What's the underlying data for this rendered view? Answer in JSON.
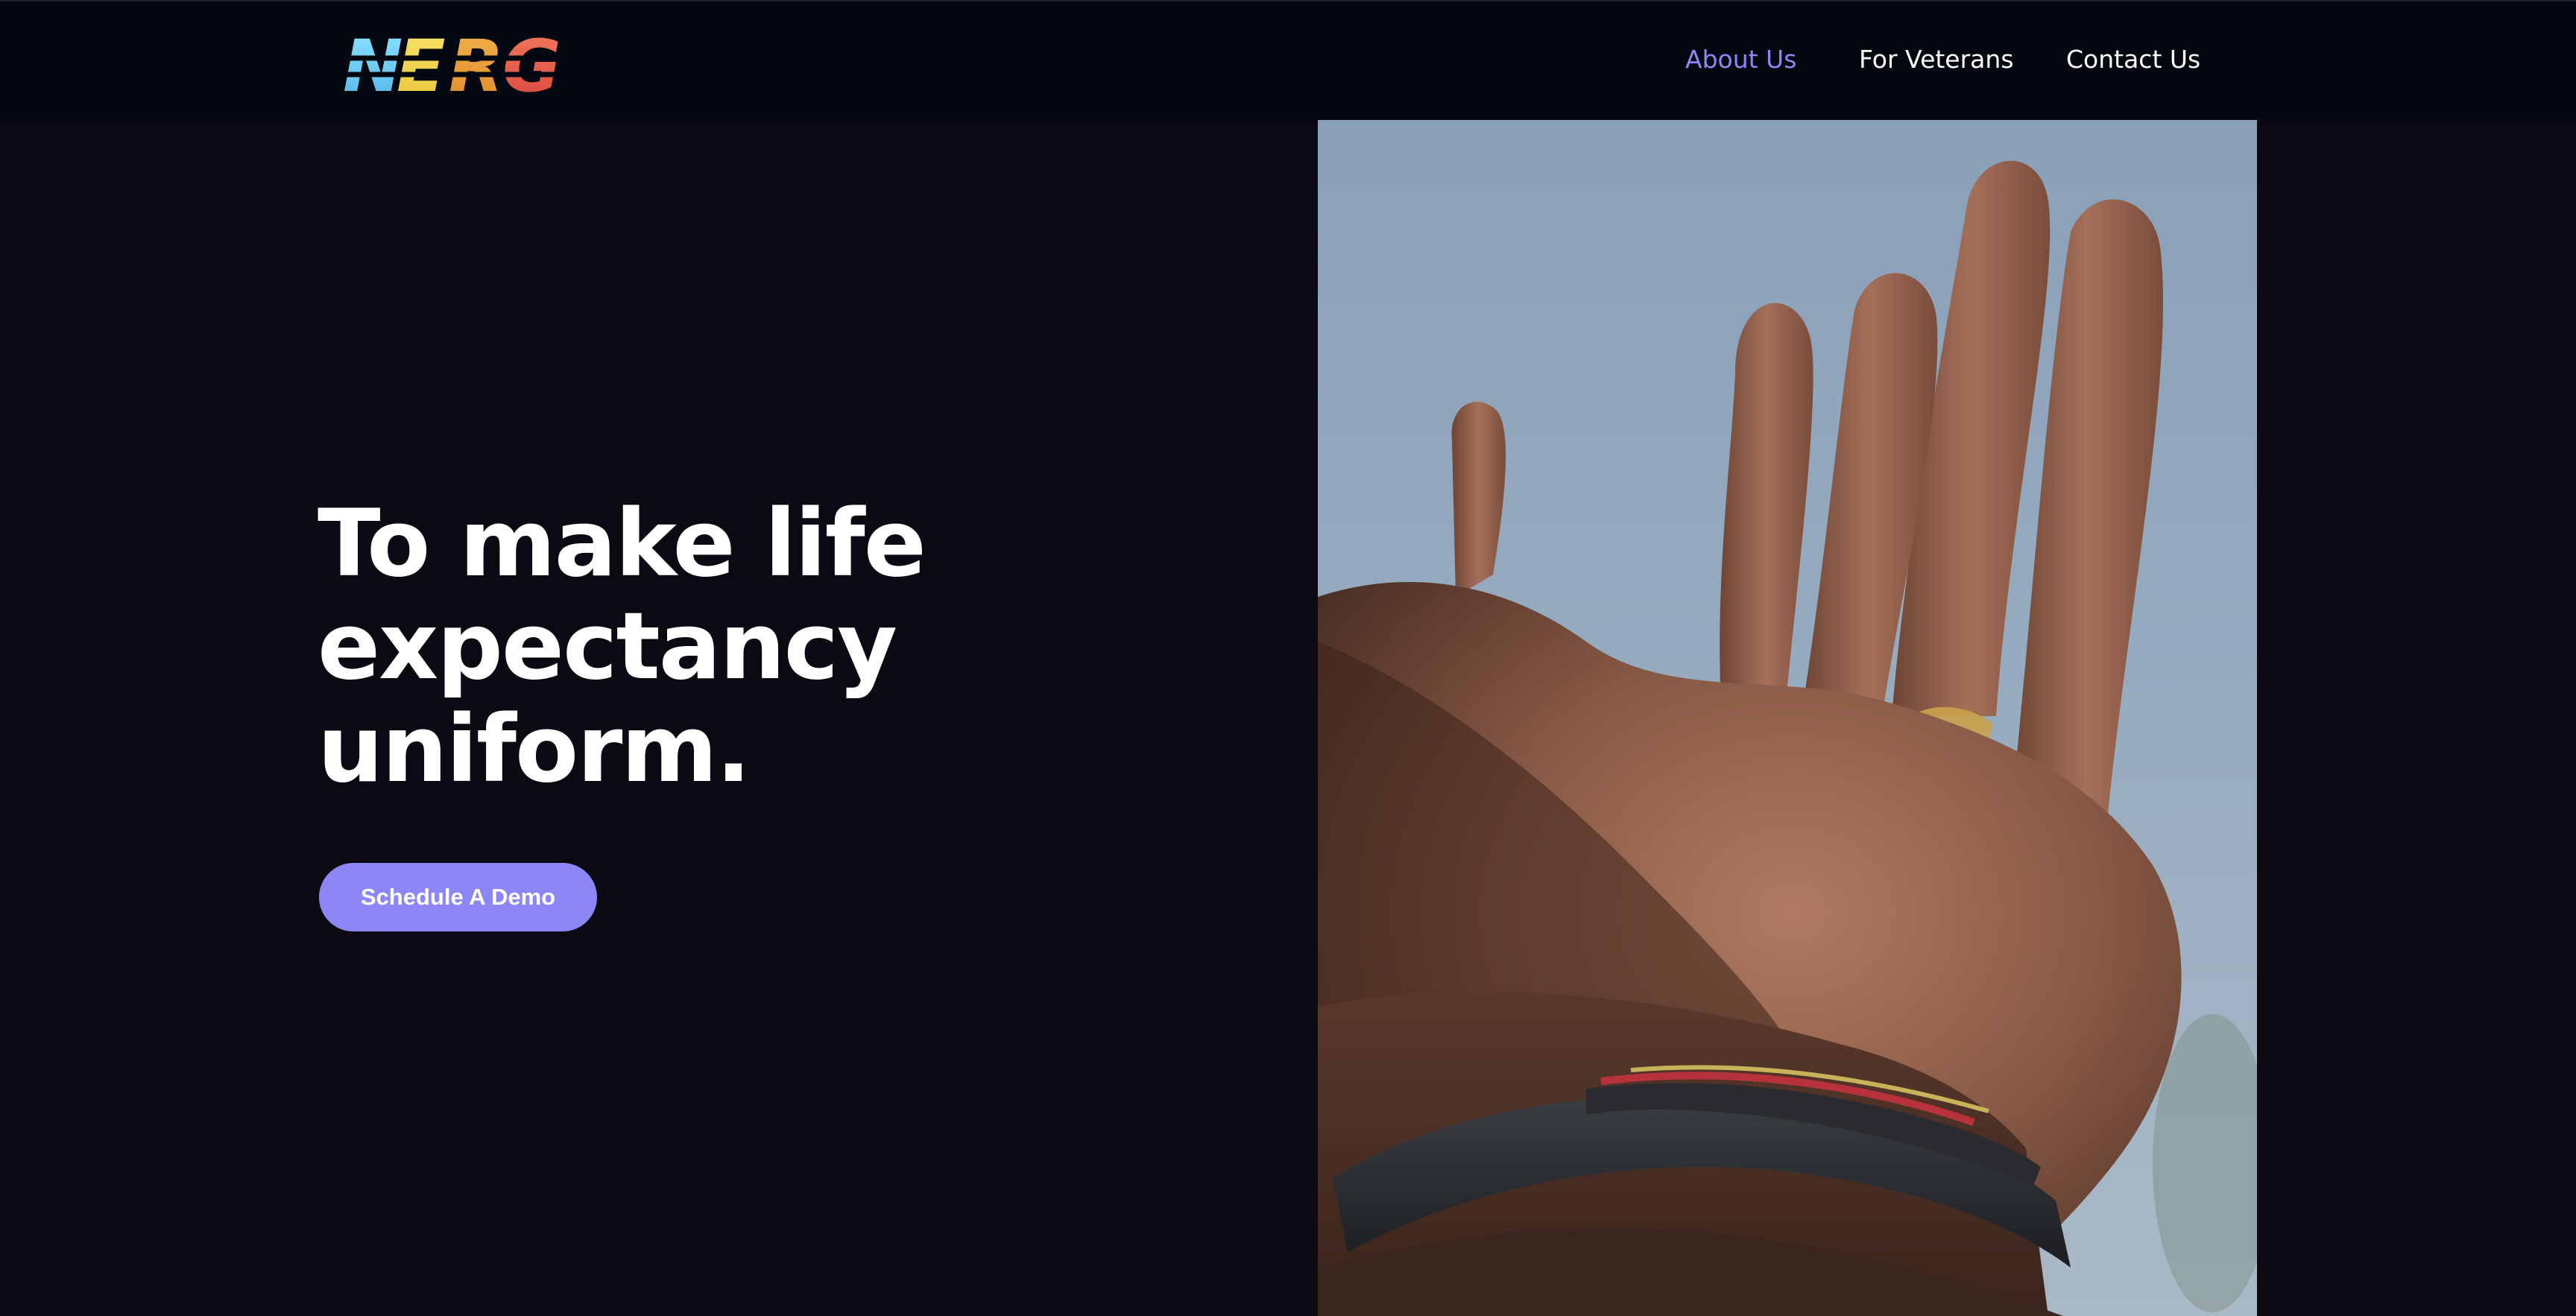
{
  "brand": {
    "name": "NERG",
    "letters": [
      "N",
      "E",
      "R",
      "G"
    ],
    "letter_colors": [
      "#6fd3f5",
      "#f2d64a",
      "#e99a34",
      "#e8634a"
    ]
  },
  "nav": {
    "items": [
      {
        "label": "About Us",
        "active": true
      },
      {
        "label": "For Veterans",
        "active": false
      },
      {
        "label": "Contact Us",
        "active": false
      }
    ]
  },
  "hero": {
    "headline_lines": [
      "To make life",
      "expectancy",
      "uniform."
    ],
    "cta_label": "Schedule A Demo",
    "image_subject": "open-palm-hand-photo"
  },
  "colors": {
    "nav_background": "#040911",
    "page_background": "#0b0911",
    "accent": "#8d86f6",
    "active_link": "#8f86f6",
    "text": "#ffffff"
  }
}
